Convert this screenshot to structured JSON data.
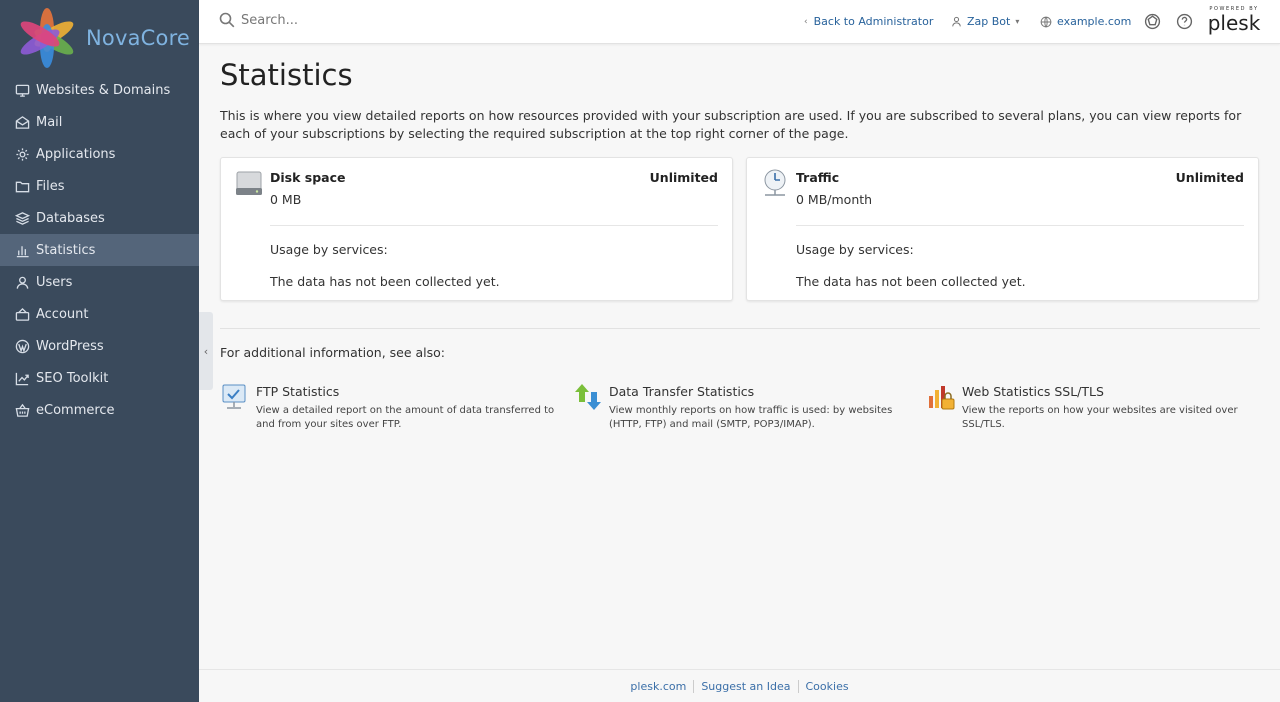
{
  "brand": {
    "name": "NovaCore"
  },
  "sidebar": {
    "items": [
      {
        "label": "Websites & Domains",
        "icon": "monitor-icon"
      },
      {
        "label": "Mail",
        "icon": "envelope-icon"
      },
      {
        "label": "Applications",
        "icon": "gear-icon"
      },
      {
        "label": "Files",
        "icon": "folder-icon"
      },
      {
        "label": "Databases",
        "icon": "layers-icon"
      },
      {
        "label": "Statistics",
        "icon": "bar-chart-icon",
        "active": true
      },
      {
        "label": "Users",
        "icon": "user-icon"
      },
      {
        "label": "Account",
        "icon": "account-icon"
      },
      {
        "label": "WordPress",
        "icon": "wordpress-icon"
      },
      {
        "label": "SEO Toolkit",
        "icon": "seo-icon"
      },
      {
        "label": "eCommerce",
        "icon": "basket-icon"
      }
    ],
    "collapse_glyph": "‹"
  },
  "header": {
    "search_placeholder": "Search...",
    "back_label": "Back to Administrator",
    "user_label": "Zap Bot",
    "domain_label": "example.com",
    "powered_by": "POWERED BY",
    "powered_brand": "plesk"
  },
  "main": {
    "title": "Statistics",
    "intro": "This is where you view detailed reports on how resources provided with your subscription are used. If you are subscribed to several plans, you can view reports for each of your subscriptions by selecting the required subscription at the top right corner of the page.",
    "cards": [
      {
        "title": "Disk space",
        "value": "0 MB",
        "limit": "Unlimited",
        "usage_label": "Usage by services:",
        "nodata": "The data has not been collected yet."
      },
      {
        "title": "Traffic",
        "value": "0 MB/month",
        "limit": "Unlimited",
        "usage_label": "Usage by services:",
        "nodata": "The data has not been collected yet."
      }
    ],
    "see_also": "For additional information, see also:",
    "related": [
      {
        "title": "FTP Statistics",
        "desc": "View a detailed report on the amount of data transferred to and from your sites over FTP."
      },
      {
        "title": "Data Transfer Statistics",
        "desc": "View monthly reports on how traffic is used: by websites (HTTP, FTP) and mail (SMTP, POP3/IMAP)."
      },
      {
        "title": "Web Statistics SSL/TLS",
        "desc": "View the reports on how your websites are visited over SSL/TLS."
      }
    ]
  },
  "footer": {
    "links": [
      "plesk.com",
      "Suggest an Idea",
      "Cookies"
    ]
  }
}
